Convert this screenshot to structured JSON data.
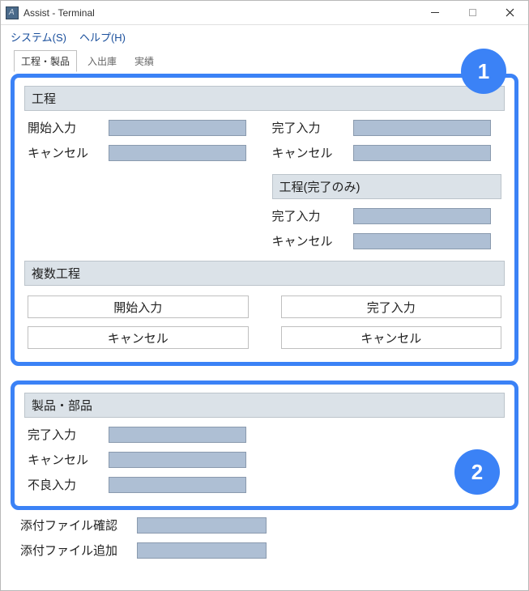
{
  "window": {
    "title": "Assist - Terminal"
  },
  "menu": {
    "system": "システム(S)",
    "help": "ヘルプ(H)"
  },
  "tabs": {
    "t1": "工程・製品",
    "t2": "入出庫",
    "t3": "実績"
  },
  "annot": {
    "badge1": "1",
    "badge2": "2"
  },
  "section1": {
    "header": "工程",
    "left": {
      "start_input": "開始入力",
      "cancel": "キャンセル"
    },
    "right": {
      "complete_input": "完了入力",
      "cancel": "キャンセル"
    },
    "sub_header": "工程(完了のみ)",
    "right2": {
      "complete_input": "完了入力",
      "cancel": "キャンセル"
    }
  },
  "section_multi": {
    "header": "複数工程",
    "btn_start": "開始入力",
    "btn_complete": "完了入力",
    "btn_cancel_l": "キャンセル",
    "btn_cancel_r": "キャンセル"
  },
  "section2": {
    "header": "製品・部品",
    "complete_input": "完了入力",
    "cancel": "キャンセル",
    "defect_input": "不良入力"
  },
  "attach": {
    "confirm": "添付ファイル確認",
    "add": "添付ファイル追加"
  }
}
